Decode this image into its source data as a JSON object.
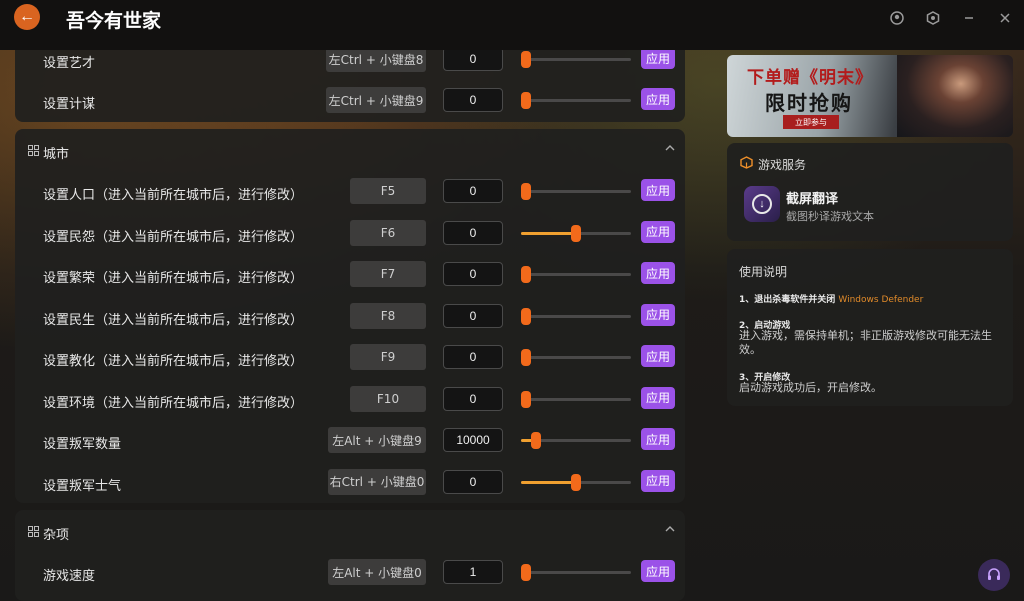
{
  "app": {
    "title": "吾今有世家"
  },
  "top_rows": [
    {
      "label": "设置艺才",
      "hotkey": "左Ctrl + 小键盘8",
      "value": "0",
      "apply": "应用"
    },
    {
      "label": "设置计谋",
      "hotkey": "左Ctrl + 小键盘9",
      "value": "0",
      "apply": "应用"
    }
  ],
  "sections": [
    {
      "title": "城市",
      "rows": [
        {
          "label": "设置人口（进入当前所在城市后，进行修改）",
          "hotkey": "F5",
          "value": "0",
          "apply": "应用"
        },
        {
          "label": "设置民怨（进入当前所在城市后，进行修改）",
          "hotkey": "F6",
          "value": "0",
          "apply": "应用"
        },
        {
          "label": "设置繁荣（进入当前所在城市后，进行修改）",
          "hotkey": "F7",
          "value": "0",
          "apply": "应用"
        },
        {
          "label": "设置民生（进入当前所在城市后，进行修改）",
          "hotkey": "F8",
          "value": "0",
          "apply": "应用"
        },
        {
          "label": "设置教化（进入当前所在城市后，进行修改）",
          "hotkey": "F9",
          "value": "0",
          "apply": "应用"
        },
        {
          "label": "设置环境（进入当前所在城市后，进行修改）",
          "hotkey": "F10",
          "value": "0",
          "apply": "应用"
        },
        {
          "label": "设置叛军数量",
          "hotkey": "左Alt + 小键盘9",
          "value": "10000",
          "apply": "应用"
        },
        {
          "label": "设置叛军士气",
          "hotkey": "右Ctrl + 小键盘0",
          "value": "0",
          "apply": "应用"
        }
      ]
    },
    {
      "title": "杂项",
      "rows": [
        {
          "label": "游戏速度",
          "hotkey": "左Alt + 小键盘0",
          "value": "1",
          "apply": "应用"
        }
      ]
    }
  ],
  "slider_levels": {
    "top": [
      0,
      0
    ],
    "city": [
      0,
      0.5,
      0,
      0,
      0,
      0,
      0.1,
      0.5
    ],
    "misc": [
      0
    ]
  },
  "banner": {
    "line1": "下单赠《明末》",
    "line2": "限时抢购",
    "cta": "立即参与"
  },
  "services": {
    "heading": "游戏服务",
    "item_name": "截屏翻译",
    "item_desc": "截图秒译游戏文本"
  },
  "guide": {
    "title": "使用说明",
    "step1_title": "1、退出杀毒软件并关闭",
    "step1_accent": "Windows Defender",
    "step2_title": "2、启动游戏",
    "step2_text": "进入游戏，需保持单机；非正版游戏修改可能无法生效。",
    "step3_title": "3、开启修改",
    "step3_text": "启动游戏成功后，开启修改。"
  },
  "colors": {
    "accent_orange": "#f26a1b",
    "apply_purple": "#9b52e8",
    "slider_fill": "#f0a030"
  }
}
